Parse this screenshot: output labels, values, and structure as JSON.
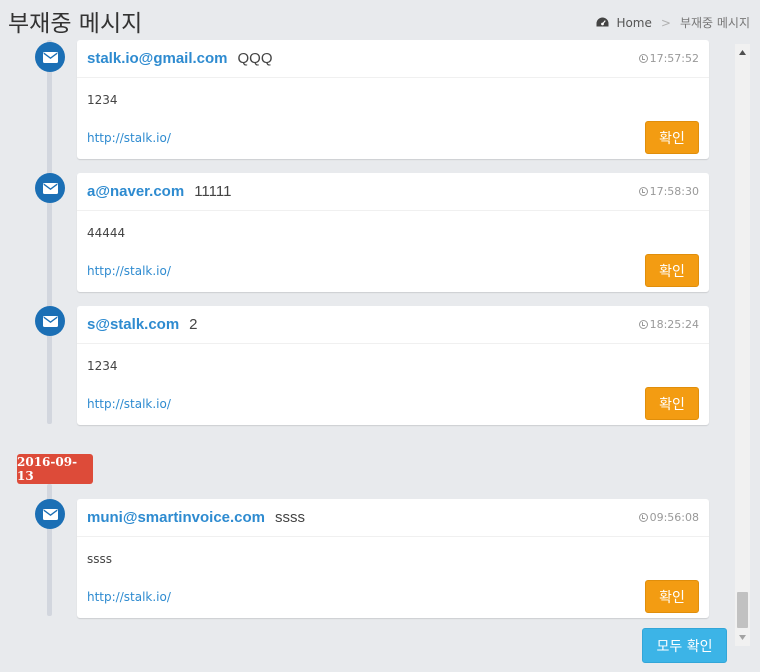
{
  "page": {
    "title": "부재중 메시지"
  },
  "breadcrumb": {
    "home_icon": "dashboard-icon",
    "home": "Home",
    "separator": ">",
    "current": "부재중 메시지"
  },
  "messages": [
    {
      "icon": "envelope-icon",
      "sender": "stalk.io@gmail.com",
      "subject": "QQQ",
      "time": "17:57:52",
      "body": "1234",
      "link": "http://stalk.io/",
      "confirm_label": "확인"
    },
    {
      "icon": "envelope-icon",
      "sender": "a@naver.com",
      "subject": "11111",
      "time": "17:58:30",
      "body": "44444",
      "link": "http://stalk.io/",
      "confirm_label": "확인"
    },
    {
      "icon": "envelope-icon",
      "sender": "s@stalk.com",
      "subject": "2",
      "time": "18:25:24",
      "body": "1234",
      "link": "http://stalk.io/",
      "confirm_label": "확인"
    },
    {
      "icon": "envelope-icon",
      "sender": "muni@smartinvoice.com",
      "subject": "ssss",
      "time": "09:56:08",
      "body": "ssss",
      "link": "http://stalk.io/",
      "confirm_label": "확인"
    }
  ],
  "date_label": "2016-09-13",
  "confirm_all_label": "모두 확인",
  "colors": {
    "accent_blue": "#1b6fb5",
    "link_blue": "#2e8bd0",
    "confirm_orange": "#f39c12",
    "date_red": "#dd4b39",
    "confirm_all_blue": "#3cb4e7"
  }
}
